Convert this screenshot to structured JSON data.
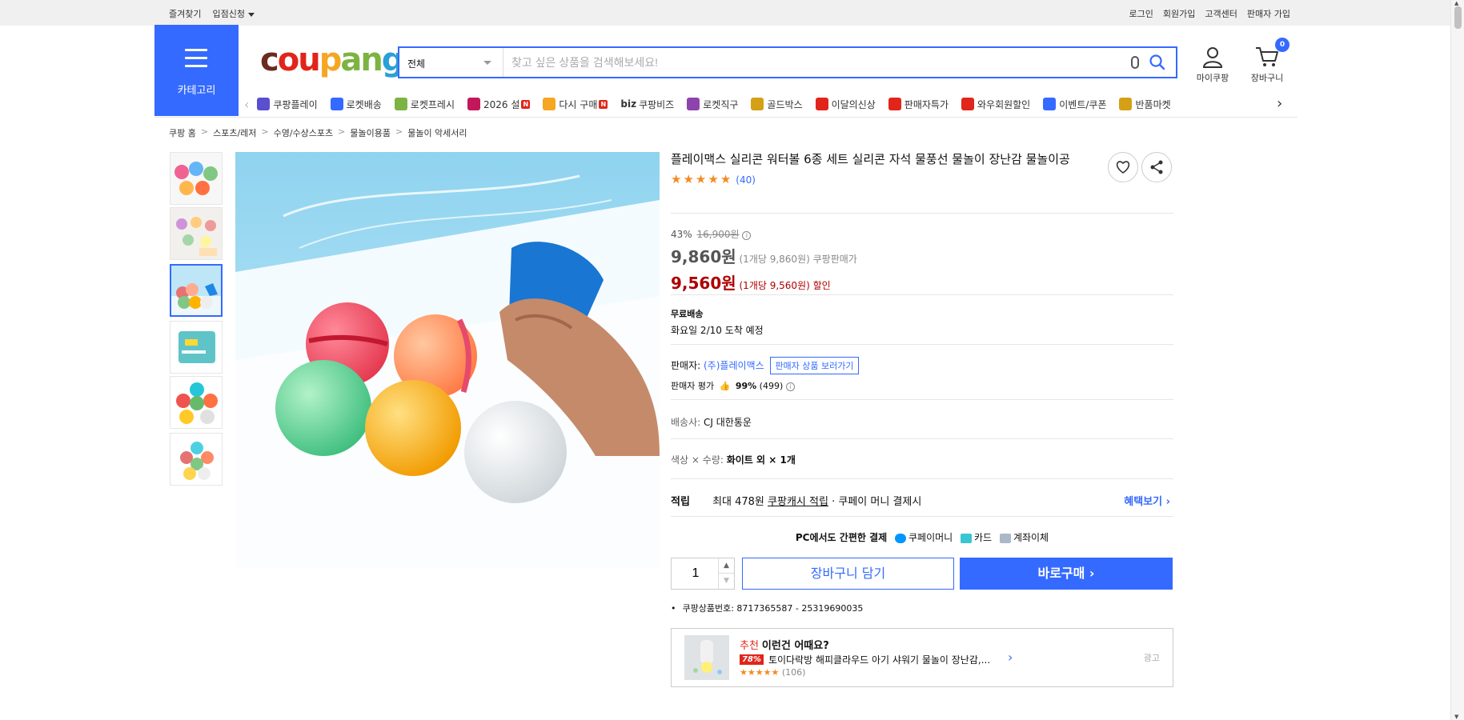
{
  "topbar": {
    "bookmark": "즐겨찾기",
    "store_apply": "입점신청",
    "login": "로그인",
    "signup": "회원가입",
    "support": "고객센터",
    "seller_signup": "판매자 가입"
  },
  "header": {
    "category_label": "카테고리",
    "logo": {
      "c": "c",
      "ou": "ou",
      "p": "p",
      "an": "an",
      "g": "g"
    },
    "search": {
      "category": "전체",
      "placeholder": "찾고 싶은 상품을 검색해보세요!"
    },
    "my_coupang": "마이쿠팡",
    "cart_label": "장바구니",
    "cart_count": "0"
  },
  "nav": [
    {
      "label": "쿠팡플레이",
      "color": "#5a4fcf",
      "new": ""
    },
    {
      "label": "로켓배송",
      "color": "#346aff",
      "new": ""
    },
    {
      "label": "로켓프레시",
      "color": "#7cb342",
      "new": ""
    },
    {
      "label": "2026 설",
      "color": "#c2185b",
      "new": "N"
    },
    {
      "label": "다시 구매",
      "color": "#f5a623",
      "new": "N"
    },
    {
      "label": "쿠팡비즈",
      "prefix": "biz",
      "color": "",
      "new": ""
    },
    {
      "label": "로켓직구",
      "color": "#8e44ad",
      "new": ""
    },
    {
      "label": "골드박스",
      "color": "#d4a017",
      "new": ""
    },
    {
      "label": "이달의신상",
      "color": "#e1251b",
      "new": ""
    },
    {
      "label": "판매자특가",
      "color": "#e1251b",
      "new": ""
    },
    {
      "label": "와우회원할인",
      "color": "#e1251b",
      "new": ""
    },
    {
      "label": "이벤트/쿠폰",
      "color": "#346aff",
      "new": ""
    },
    {
      "label": "반품마켓",
      "color": "#d4a017",
      "new": ""
    }
  ],
  "breadcrumb": [
    "쿠팡 홈",
    "스포츠/레저",
    "수영/수상스포츠",
    "물놀이용품",
    "물놀이 악세서리"
  ],
  "product": {
    "title": "플레이맥스 실리콘 워터볼 6종 세트 실리콘 자석 물풍선 물놀이 장난감 물놀이공",
    "review_count": "(40)",
    "discount_rate": "43%",
    "original_price": "16,900원",
    "price": "9,860원",
    "unit_price": "(1개당 9,860원)",
    "price_type": "쿠팡판매가",
    "sale_price": "9,560원",
    "sale_unit": "(1개당 9,560원)",
    "sale_type": "할인",
    "shipping_title": "무료배송",
    "arrival": "화요일 2/10 도착 예정",
    "seller_label": "판매자:",
    "seller_name": "(주)플레이맥스",
    "seller_btn": "판매자 상품 보러가기",
    "seller_rating_label": "판매자 평가",
    "seller_rating": "99%",
    "seller_rating_count": "(499)",
    "carrier_label": "배송사:",
    "carrier": "CJ 대한통운",
    "option_label": "색상 × 수량:",
    "option_value": "화이트 외 × 1개",
    "reward_label": "적립",
    "reward_text1": "최대 478원",
    "reward_link": "쿠팡캐시 적립",
    "reward_text2": "· 쿠페이 머니 결제시",
    "reward_more": "혜택보기",
    "pay_title": "PC에서도 간편한 결제",
    "pay_options": [
      "쿠페이머니",
      "카드",
      "계좌이체"
    ],
    "quantity": "1",
    "add_cart": "장바구니 담기",
    "buy_now": "바로구매",
    "product_number": "쿠팡상품번호: 8717365587 - 25319690035"
  },
  "recommend": {
    "tag": "추천",
    "heading": "이런건 어때요?",
    "discount": "78%",
    "name": "토이다락방 해피클라우드 아기 샤워기 물놀이 장난감,...",
    "reviews": "(106)",
    "ad": "광고"
  }
}
